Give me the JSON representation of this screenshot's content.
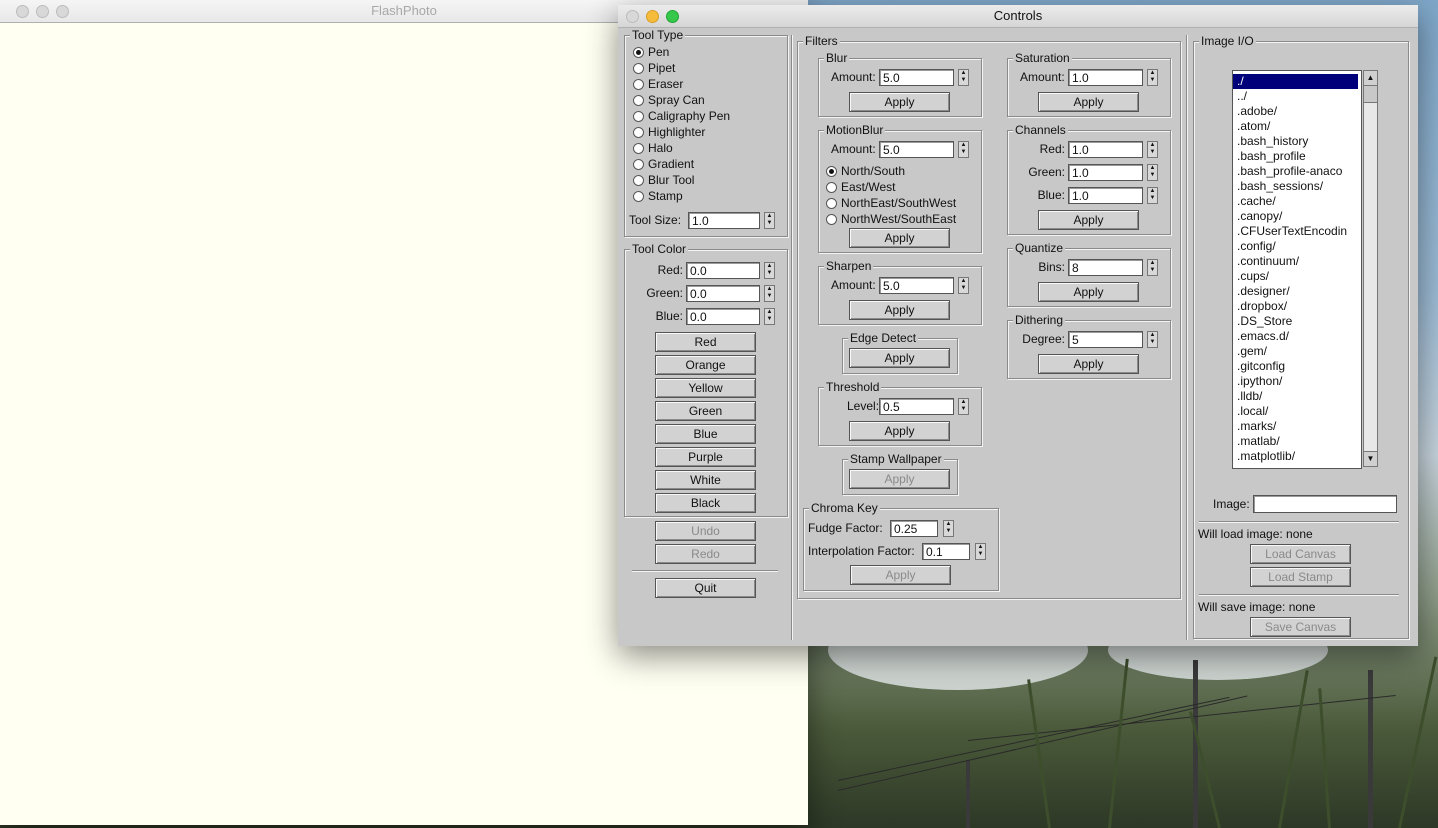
{
  "flashphoto": {
    "title": "FlashPhoto"
  },
  "controls": {
    "title": "Controls"
  },
  "tool_type": {
    "legend": "Tool Type",
    "options": [
      "Pen",
      "Pipet",
      "Eraser",
      "Spray Can",
      "Caligraphy Pen",
      "Highlighter",
      "Halo",
      "Gradient",
      "Blur Tool",
      "Stamp"
    ],
    "selected": "Pen",
    "tool_size_label": "Tool Size:",
    "tool_size_value": "1.0"
  },
  "tool_color": {
    "legend": "Tool Color",
    "red_label": "Red:",
    "red_value": "0.0",
    "green_label": "Green:",
    "green_value": "0.0",
    "blue_label": "Blue:",
    "blue_value": "0.0",
    "presets": [
      "Red",
      "Orange",
      "Yellow",
      "Green",
      "Blue",
      "Purple",
      "White",
      "Black"
    ]
  },
  "history": {
    "undo": "Undo",
    "redo": "Redo",
    "quit": "Quit"
  },
  "filters": {
    "legend": "Filters",
    "apply_label": "Apply",
    "blur": {
      "legend": "Blur",
      "amount_label": "Amount:",
      "amount": "5.0"
    },
    "motion_blur": {
      "legend": "MotionBlur",
      "amount_label": "Amount:",
      "amount": "5.0",
      "directions": [
        "North/South",
        "East/West",
        "NorthEast/SouthWest",
        "NorthWest/SouthEast"
      ],
      "selected": "North/South"
    },
    "sharpen": {
      "legend": "Sharpen",
      "amount_label": "Amount:",
      "amount": "5.0"
    },
    "edge_detect": {
      "legend": "Edge Detect"
    },
    "threshold": {
      "legend": "Threshold",
      "level_label": "Level:",
      "level": "0.5"
    },
    "stamp_wallpaper": {
      "legend": "Stamp Wallpaper"
    },
    "chroma_key": {
      "legend": "Chroma Key",
      "fudge_label": "Fudge Factor:",
      "fudge": "0.25",
      "interp_label": "Interpolation Factor:",
      "interp": "0.1"
    },
    "saturation": {
      "legend": "Saturation",
      "amount_label": "Amount:",
      "amount": "1.0"
    },
    "channels": {
      "legend": "Channels",
      "red_label": "Red:",
      "red": "1.0",
      "green_label": "Green:",
      "green": "1.0",
      "blue_label": "Blue:",
      "blue": "1.0"
    },
    "quantize": {
      "legend": "Quantize",
      "bins_label": "Bins:",
      "bins": "8"
    },
    "dithering": {
      "legend": "Dithering",
      "degree_label": "Degree:",
      "degree": "5"
    }
  },
  "image_io": {
    "legend": "Image I/O",
    "files": [
      "./",
      "../",
      ".adobe/",
      ".atom/",
      ".bash_history",
      ".bash_profile",
      ".bash_profile-anaco",
      ".bash_sessions/",
      ".cache/",
      ".canopy/",
      ".CFUserTextEncodin",
      ".config/",
      ".continuum/",
      ".cups/",
      ".designer/",
      ".dropbox/",
      ".DS_Store",
      ".emacs.d/",
      ".gem/",
      ".gitconfig",
      ".ipython/",
      ".lldb/",
      ".local/",
      ".marks/",
      ".matlab/",
      ".matplotlib/"
    ],
    "selected_file": "./",
    "image_label": "Image:",
    "image_value": "",
    "will_load": "Will load image: none",
    "load_canvas": "Load Canvas",
    "load_stamp": "Load Stamp",
    "will_save": "Will save image: none",
    "save_canvas": "Save Canvas"
  },
  "colors": {
    "canvas": "#fffff2",
    "selection": "#00007a",
    "panel": "#c8c8c8"
  }
}
